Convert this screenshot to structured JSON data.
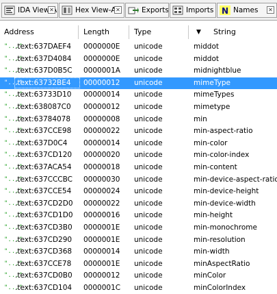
{
  "tabs": [
    {
      "label": "IDA View-A",
      "icon": "ida-view-icon"
    },
    {
      "label": "Hex View-A",
      "icon": "hex-view-icon"
    },
    {
      "label": "Exports",
      "icon": "exports-icon"
    },
    {
      "label": "Imports",
      "icon": "imports-icon"
    },
    {
      "label": "Names",
      "icon": "names-icon"
    }
  ],
  "columns": {
    "address": "Address",
    "length": "Length",
    "type": "Type",
    "string": "String"
  },
  "rows": [
    {
      "icon": "\"...\"",
      "address": ".text:637DAEF4",
      "length": "0000000E",
      "type": "unicode",
      "string": "middot"
    },
    {
      "icon": "\"...\"",
      "address": ".text:637D4084",
      "length": "0000000E",
      "type": "unicode",
      "string": "middot"
    },
    {
      "icon": "\"...\"",
      "address": ".text:637D0B5C",
      "length": "0000001A",
      "type": "unicode",
      "string": "midnightblue"
    },
    {
      "icon": "\"...\"",
      "address": ".text:63732BE4",
      "length": "00000012",
      "type": "unicode",
      "string": "mimeType",
      "selected": true
    },
    {
      "icon": "\"...\"",
      "address": ".text:63733D10",
      "length": "00000014",
      "type": "unicode",
      "string": "mimeTypes"
    },
    {
      "icon": "\"...\"",
      "address": ".text:638087C0",
      "length": "00000012",
      "type": "unicode",
      "string": "mimetype"
    },
    {
      "icon": "\"...\"",
      "address": ".text:63784078",
      "length": "00000008",
      "type": "unicode",
      "string": "min"
    },
    {
      "icon": "\"...\"",
      "address": ".text:637CCE98",
      "length": "00000022",
      "type": "unicode",
      "string": "min-aspect-ratio"
    },
    {
      "icon": "\"...\"",
      "address": ".text:637D0C4",
      "length": "00000014",
      "type": "unicode",
      "string": "min-color"
    },
    {
      "icon": "\"...\"",
      "address": ".text:637CD120",
      "length": "00000020",
      "type": "unicode",
      "string": "min-color-index"
    },
    {
      "icon": "\"...\"",
      "address": ".text:637ACA54",
      "length": "00000018",
      "type": "unicode",
      "string": "min-content"
    },
    {
      "icon": "\"...\"",
      "address": ".text:637CCCBC",
      "length": "00000030",
      "type": "unicode",
      "string": "min-device-aspect-ratio"
    },
    {
      "icon": "\"...\"",
      "address": ".text:637CCE54",
      "length": "00000024",
      "type": "unicode",
      "string": "min-device-height"
    },
    {
      "icon": "\"...\"",
      "address": ".text:637CD2D0",
      "length": "00000022",
      "type": "unicode",
      "string": "min-device-width"
    },
    {
      "icon": "\"...\"",
      "address": ".text:637CD1D0",
      "length": "00000016",
      "type": "unicode",
      "string": "min-height"
    },
    {
      "icon": "\"...\"",
      "address": ".text:637CD3B0",
      "length": "0000001E",
      "type": "unicode",
      "string": "min-monochrome"
    },
    {
      "icon": "\"...\"",
      "address": ".text:637CD290",
      "length": "0000001E",
      "type": "unicode",
      "string": "min-resolution"
    },
    {
      "icon": "\"...\"",
      "address": ".text:637CD368",
      "length": "00000014",
      "type": "unicode",
      "string": "min-width"
    },
    {
      "icon": "\"...\"",
      "address": ".text:637CCE78",
      "length": "0000001E",
      "type": "unicode",
      "string": "minAspectRatio"
    },
    {
      "icon": "\"...\"",
      "address": ".text:637CD0B0",
      "length": "00000012",
      "type": "unicode",
      "string": "minColor"
    },
    {
      "icon": "\"...\"",
      "address": ".text:637CD104",
      "length": "0000001C",
      "type": "unicode",
      "string": "minColorIndex"
    }
  ],
  "colors": {
    "selection": "#3399ff",
    "string_icon": "#22a022"
  }
}
